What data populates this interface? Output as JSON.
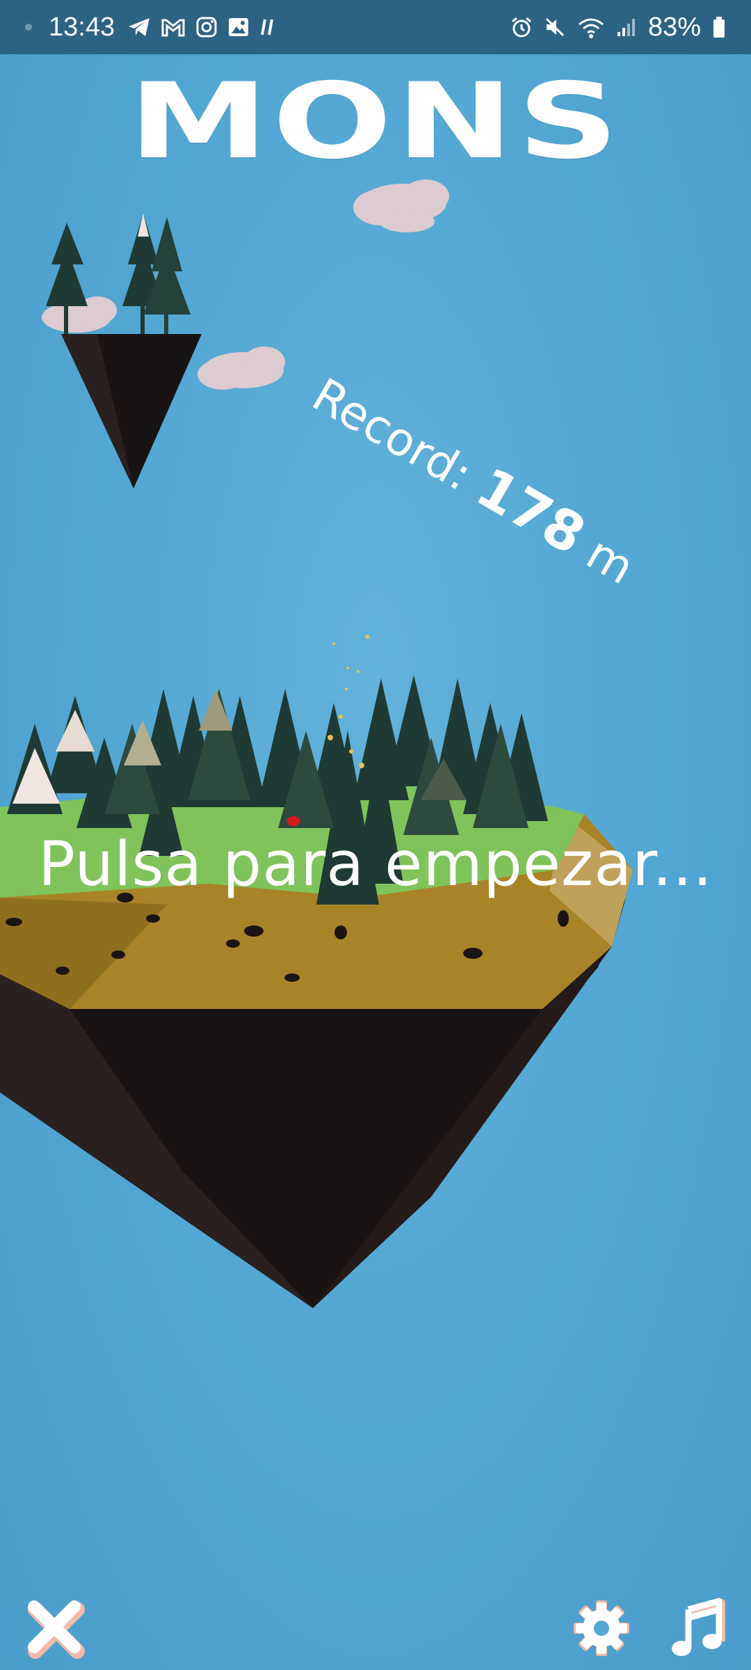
{
  "status_bar": {
    "time": "13:43",
    "battery": "83%",
    "left_icons": [
      "telegram-icon",
      "gmail-icon",
      "instagram-icon",
      "gallery-icon",
      "app-icon"
    ],
    "right_icons": [
      "alarm-icon",
      "mute-icon",
      "wifi-icon",
      "signal-icon",
      "battery-icon"
    ]
  },
  "game": {
    "title": "MONS",
    "record_label": "Record:",
    "record_value": "178",
    "record_unit": "m",
    "start_prompt": "Pulsa para empezar..."
  },
  "controls": {
    "close": "close-icon",
    "settings": "gear-icon",
    "music": "music-icon"
  },
  "colors": {
    "sky": "#54a8d3",
    "status_bar": "#2c6384",
    "grass": "#7fc35a",
    "soil": "#a88327",
    "rock": "#1c1414",
    "tree": "#1f3a34",
    "cloud": "#d9c9cf",
    "button_accent": "#f2b8a8"
  }
}
